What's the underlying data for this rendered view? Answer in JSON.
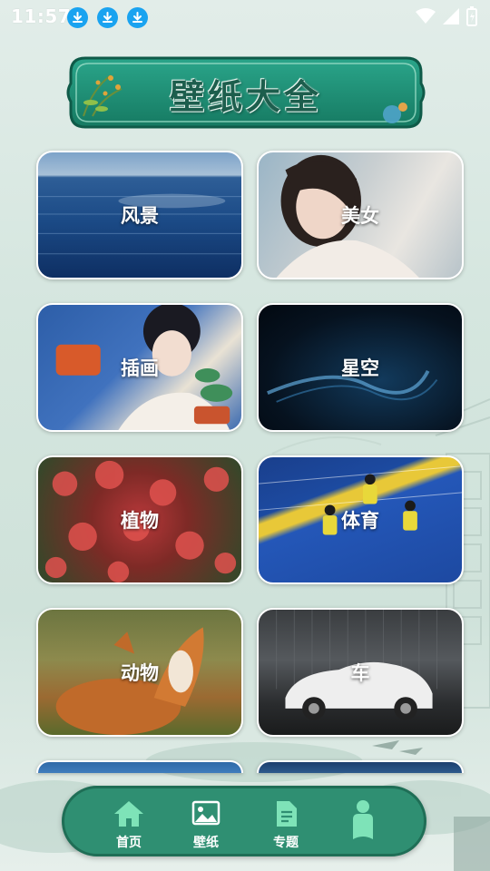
{
  "status_bar": {
    "time": "11:57",
    "download_icons": [
      "download-icon",
      "download-icon",
      "download-icon"
    ],
    "system_icons": [
      "wifi-icon",
      "signal-icon",
      "battery-charging-icon"
    ]
  },
  "header": {
    "title": "壁纸大全"
  },
  "categories": [
    {
      "label": "风景"
    },
    {
      "label": "美女"
    },
    {
      "label": "插画"
    },
    {
      "label": "星空"
    },
    {
      "label": "植物"
    },
    {
      "label": "体育"
    },
    {
      "label": "动物"
    },
    {
      "label": "车"
    }
  ],
  "bottom_nav": {
    "items": [
      {
        "label": "首页",
        "icon": "home-icon"
      },
      {
        "label": "壁纸",
        "icon": "image-icon"
      },
      {
        "label": "专题",
        "icon": "document-icon"
      },
      {
        "label": "",
        "icon": "person-icon"
      }
    ]
  },
  "colors": {
    "accent": "#2f8f72",
    "title_text": "#1d5e4d",
    "download_badge": "#1aa3f0",
    "nav_icon": "#7ee3b8"
  }
}
